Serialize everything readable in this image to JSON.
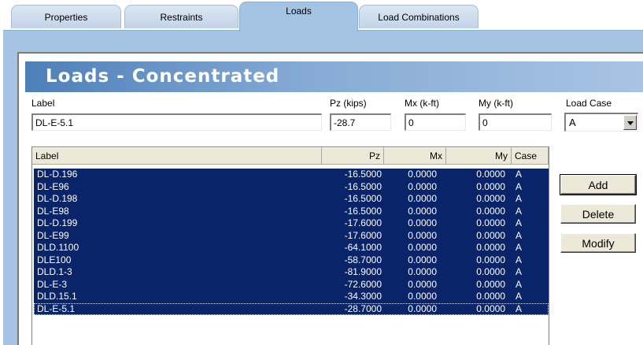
{
  "tabs": [
    {
      "label": "Properties",
      "active": false
    },
    {
      "label": "Restraints",
      "active": false
    },
    {
      "label": "Loads",
      "active": true
    },
    {
      "label": "Load Combinations",
      "active": false
    }
  ],
  "section_title": "Loads - Concentrated",
  "form": {
    "label_caption": "Label",
    "label_value": "DL-E-5.1",
    "pz_caption": "Pz (kips)",
    "pz_value": "-28.7",
    "mx_caption": "Mx (k-ft)",
    "mx_value": "0",
    "my_caption": "My (k-ft)",
    "my_value": "0",
    "load_case_caption": "Load Case",
    "load_case_value": "A"
  },
  "table": {
    "columns": [
      "Label",
      "Pz",
      "Mx",
      "My",
      "Case"
    ],
    "rows": [
      [
        "DL-D.196",
        "-16.5000",
        "0.0000",
        "0.0000",
        "A"
      ],
      [
        "DL-E96",
        "-16.5000",
        "0.0000",
        "0.0000",
        "A"
      ],
      [
        "DL-D.198",
        "-16.5000",
        "0.0000",
        "0.0000",
        "A"
      ],
      [
        "DL-E98",
        "-16.5000",
        "0.0000",
        "0.0000",
        "A"
      ],
      [
        "DL-D.199",
        "-17.6000",
        "0.0000",
        "0.0000",
        "A"
      ],
      [
        "DL-E99",
        "-17.6000",
        "0.0000",
        "0.0000",
        "A"
      ],
      [
        "DLD.1100",
        "-64.1000",
        "0.0000",
        "0.0000",
        "A"
      ],
      [
        "DLE100",
        "-58.7000",
        "0.0000",
        "0.0000",
        "A"
      ],
      [
        "DLD.1-3",
        "-81.9000",
        "0.0000",
        "0.0000",
        "A"
      ],
      [
        "DL-E-3",
        "-72.6000",
        "0.0000",
        "0.0000",
        "A"
      ],
      [
        "DLD.15.1",
        "-34.3000",
        "0.0000",
        "0.0000",
        "A"
      ],
      [
        "DL-E-5.1",
        "-28.7000",
        "0.0000",
        "0.0000",
        "A"
      ]
    ]
  },
  "buttons": {
    "add": "Add",
    "delete": "Delete",
    "modify": "Modify"
  }
}
